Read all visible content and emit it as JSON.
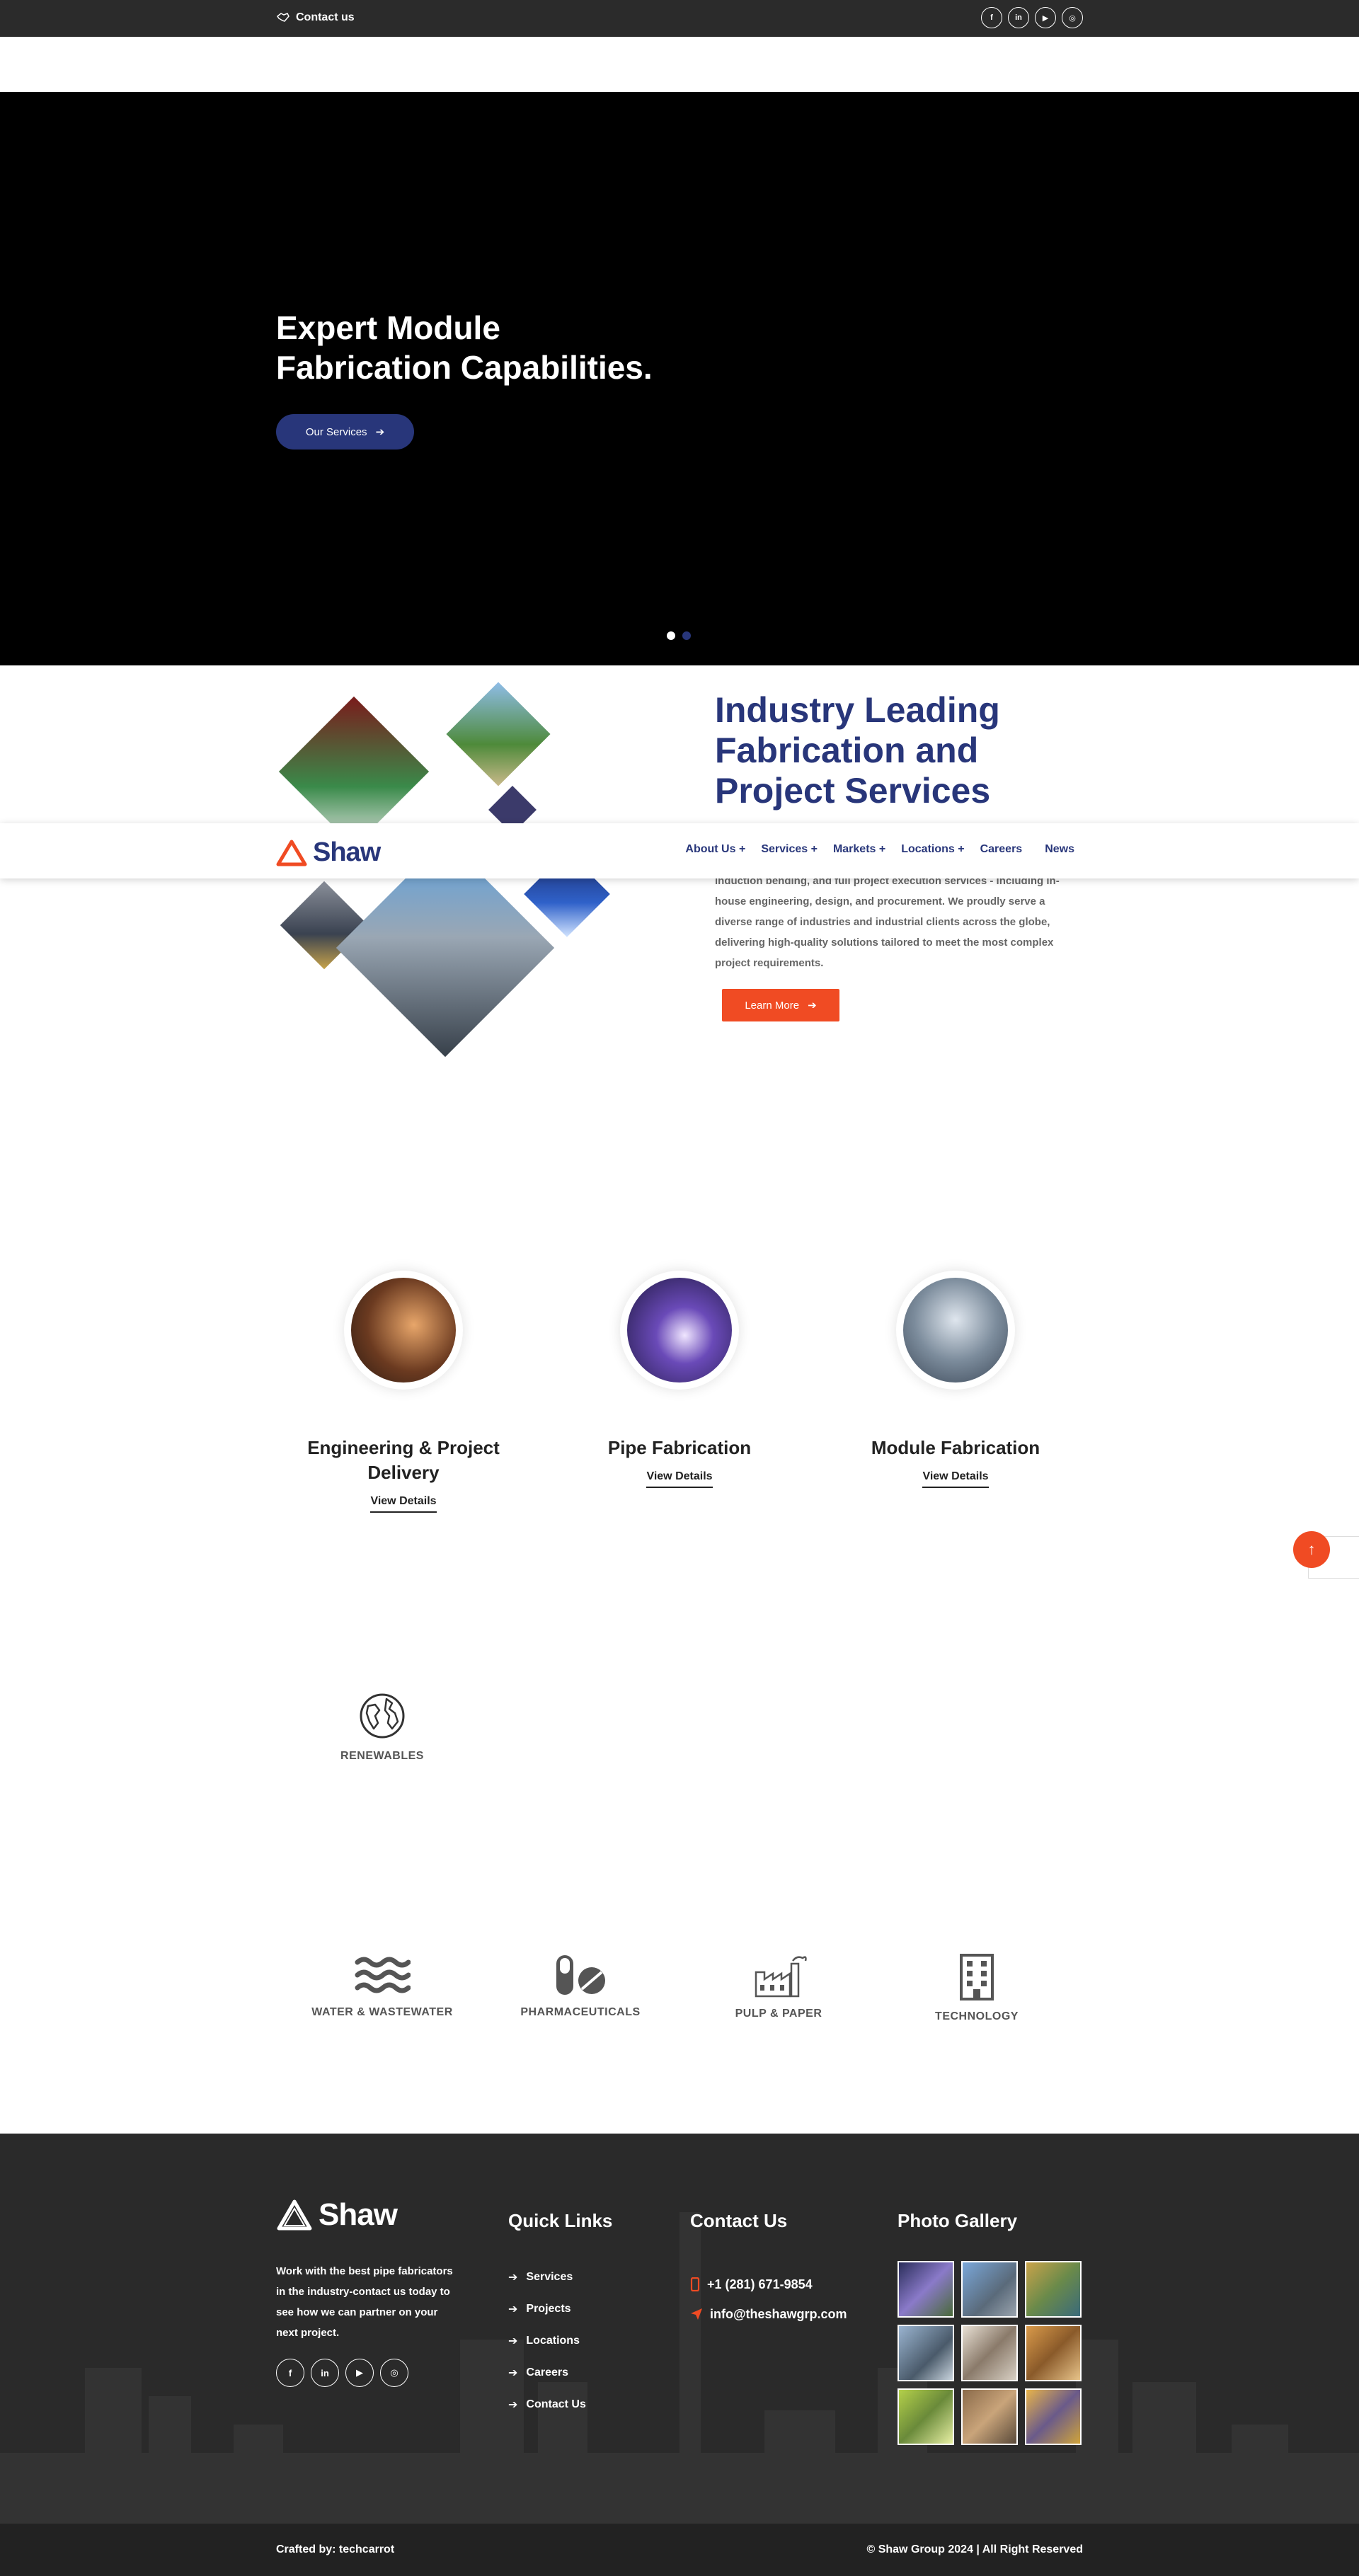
{
  "topbar": {
    "contact_label": "Contact us",
    "socials": [
      "facebook-icon",
      "linkedin-icon",
      "youtube-icon",
      "instagram-icon"
    ]
  },
  "hero": {
    "title_line1": "Expert Module",
    "title_line2": "Fabrication Capabilities.",
    "button_label": "Our Services",
    "slides_count": 2,
    "active_slide": 1
  },
  "navbar": {
    "logo_text": "Shaw",
    "items": [
      {
        "label": "About Us",
        "has_dropdown": true
      },
      {
        "label": "Services",
        "has_dropdown": true
      },
      {
        "label": "Markets",
        "has_dropdown": true
      },
      {
        "label": "Locations",
        "has_dropdown": true
      },
      {
        "label": "Careers",
        "has_dropdown": false
      },
      {
        "label": "News",
        "has_dropdown": false
      }
    ]
  },
  "intro": {
    "title_line1": "Industry Leading",
    "title_line2": "Fabrication and",
    "title_line3": "Project Services",
    "text": "induction bending, and full project execution services - including in-house engineering, design, and procurement. We proudly serve a diverse range of industries and industrial clients across the globe, delivering high-quality solutions tailored to meet the most complex project requirements.",
    "button_label": "Learn More"
  },
  "services": [
    {
      "title_line1": "Engineering & Project",
      "title_line2": "Delivery",
      "link_label": "View Details"
    },
    {
      "title_line1": "Pipe Fabrication",
      "title_line2": "",
      "link_label": "View Details"
    },
    {
      "title_line1": "Module Fabrication",
      "title_line2": "",
      "link_label": "View Details"
    }
  ],
  "markets": [
    {
      "label": "RENEWABLES",
      "icon": "globe-icon"
    },
    {
      "label": "WATER & WASTEWATER",
      "icon": "water-waves-icon"
    },
    {
      "label": "PHARMACEUTICALS",
      "icon": "pills-icon"
    },
    {
      "label": "PULP & PAPER",
      "icon": "factory-icon"
    },
    {
      "label": "TECHNOLOGY",
      "icon": "building-icon"
    }
  ],
  "footer": {
    "logo_text": "Shaw",
    "description": "Work with the best pipe fabricators in the industry-contact us today to see how we can partner on your next project.",
    "quick_links_title": "Quick Links",
    "quick_links": [
      "Services",
      "Projects",
      "Locations",
      "Careers",
      "Contact Us"
    ],
    "contact_title": "Contact Us",
    "phone": "+1 (281) 671-9854",
    "email": "info@theshawgrp.com",
    "gallery_title": "Photo Gallery",
    "credit": "Crafted by: techcarrot",
    "copyright": "© Shaw Group 2024 | All Right Reserved"
  },
  "colors": {
    "brand_blue": "#28367a",
    "accent_orange": "#f04b23",
    "dark": "#2a2a2a"
  }
}
